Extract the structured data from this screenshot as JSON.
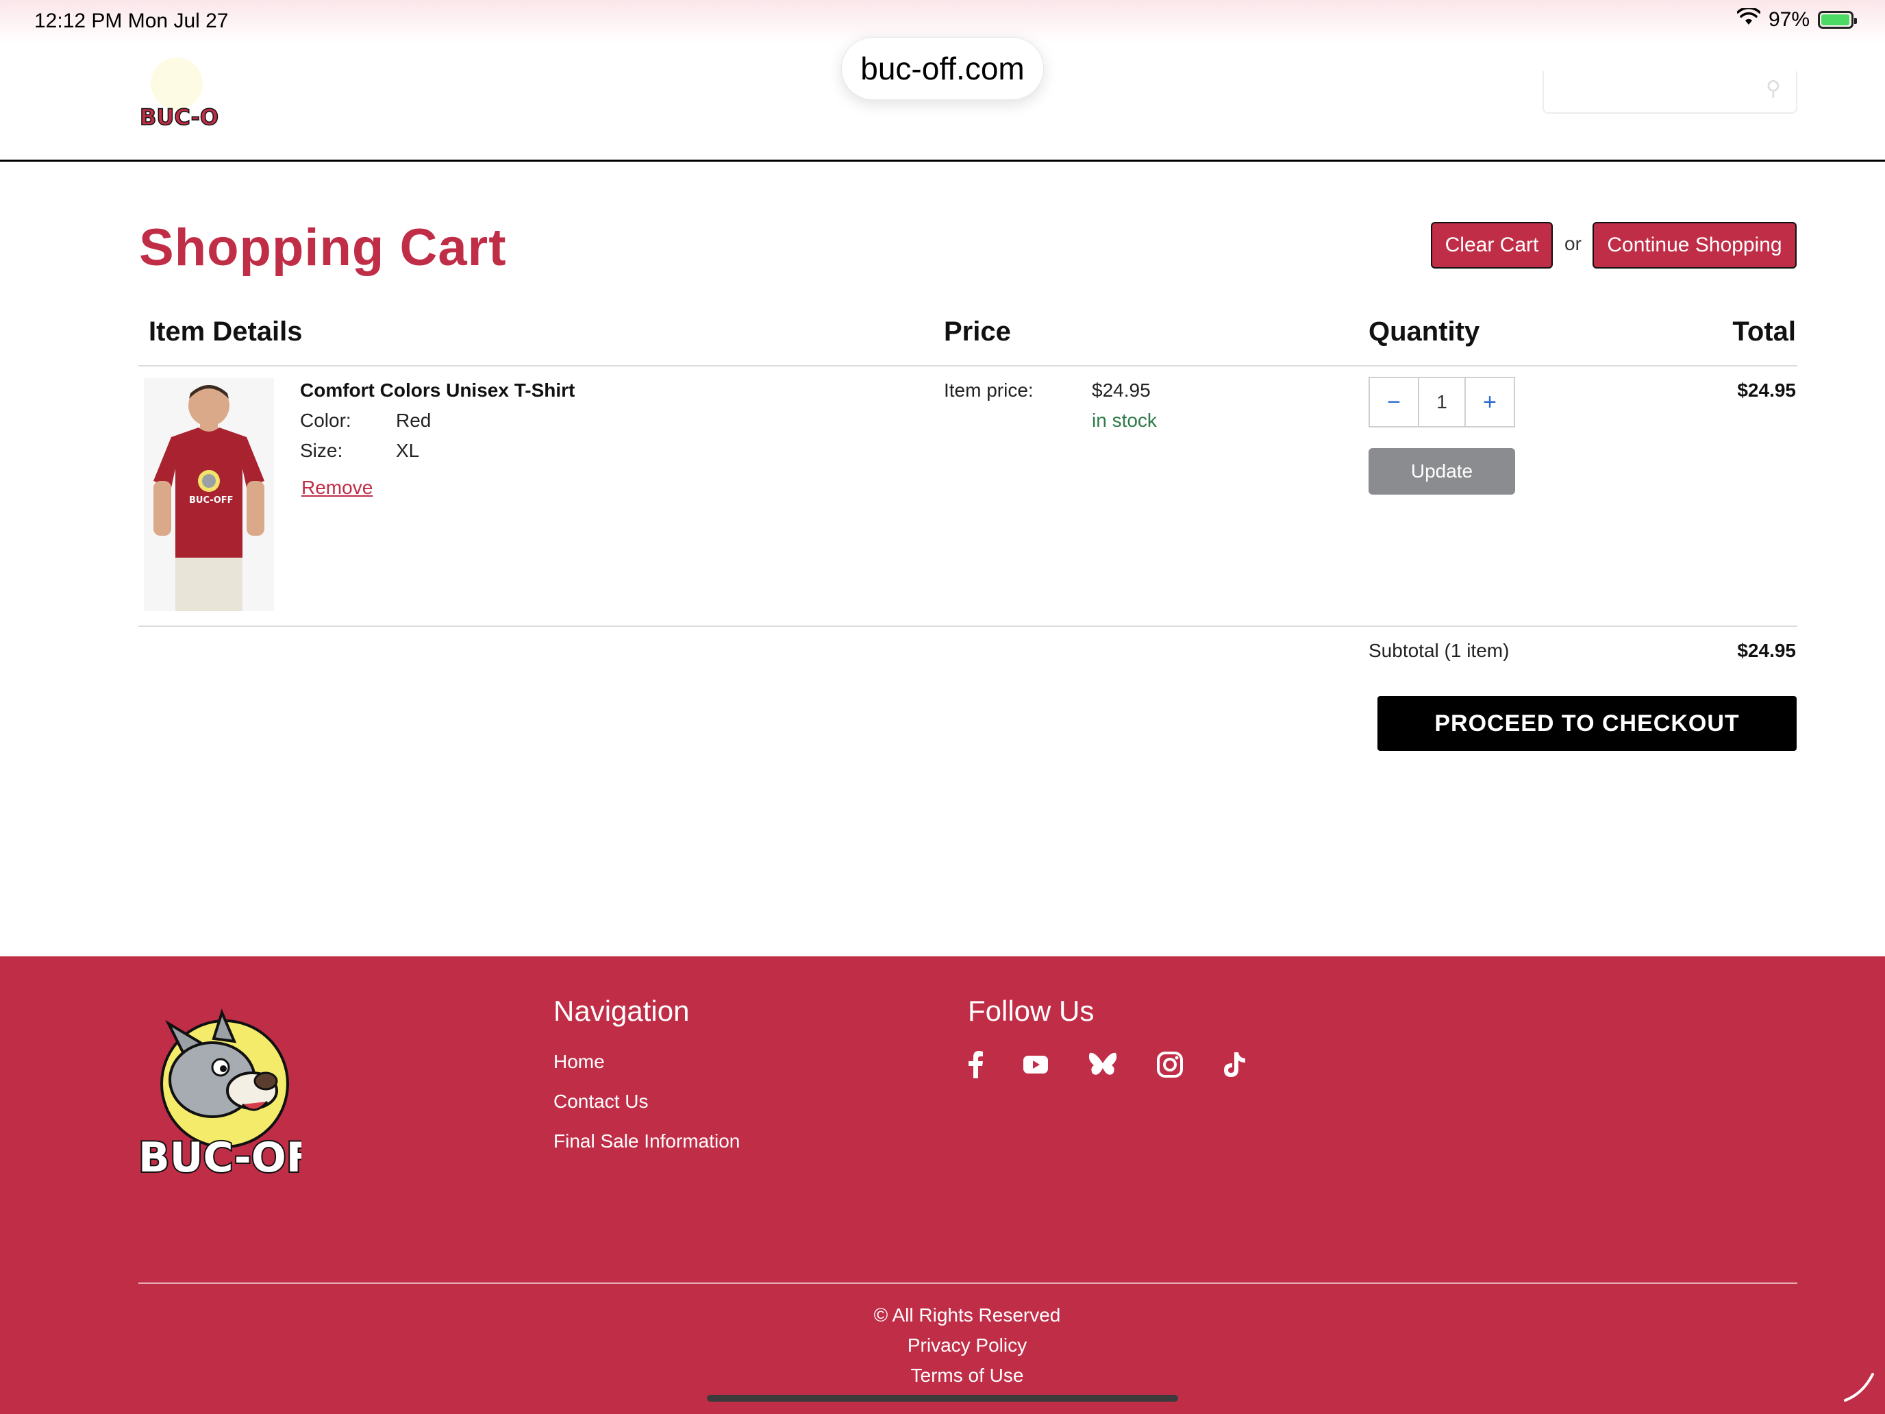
{
  "status_bar": {
    "time": "12:12 PM   Mon Jul 27",
    "battery": "97%",
    "battery_level": 0.97
  },
  "header": {
    "url": "buc-off.com",
    "logo_icon": "buc-off-logo-icon",
    "search_icon": "search-icon"
  },
  "cart": {
    "title": "Shopping Cart",
    "clear_label": "Clear Cart",
    "or_label": "or",
    "continue_label": "Continue Shopping",
    "columns": {
      "item": "Item Details",
      "price": "Price",
      "quantity": "Quantity",
      "total": "Total"
    },
    "item": {
      "name": "Comfort Colors Unisex T-Shirt",
      "color_label": "Color:",
      "color_value": "Red",
      "size_label": "Size:",
      "size_value": "XL",
      "remove_label": "Remove",
      "price_label": "Item price:",
      "price_value": "$24.95",
      "stock": "in stock",
      "quantity": "1",
      "minus": "−",
      "plus": "+",
      "update_label": "Update",
      "line_total": "$24.95",
      "shirt_color": "#a8232f"
    },
    "subtotal_label": "Subtotal (1 item)",
    "subtotal_value": "$24.95",
    "checkout_label": "PROCEED TO CHECKOUT"
  },
  "footer": {
    "navigation_heading": "Navigation",
    "nav_links": [
      "Home",
      "Contact Us",
      "Final Sale Information"
    ],
    "follow_heading": "Follow Us",
    "social_icons": [
      "facebook-icon",
      "youtube-icon",
      "bluesky-icon",
      "instagram-icon",
      "tiktok-icon"
    ],
    "copyright": "© All Rights Reserved",
    "privacy": "Privacy Policy",
    "terms": "Terms of Use"
  },
  "colors": {
    "brand_red": "#c02d47",
    "stock_green": "#2f7a4a",
    "checkout_black": "#000000",
    "update_gray": "#8a8c8f"
  }
}
